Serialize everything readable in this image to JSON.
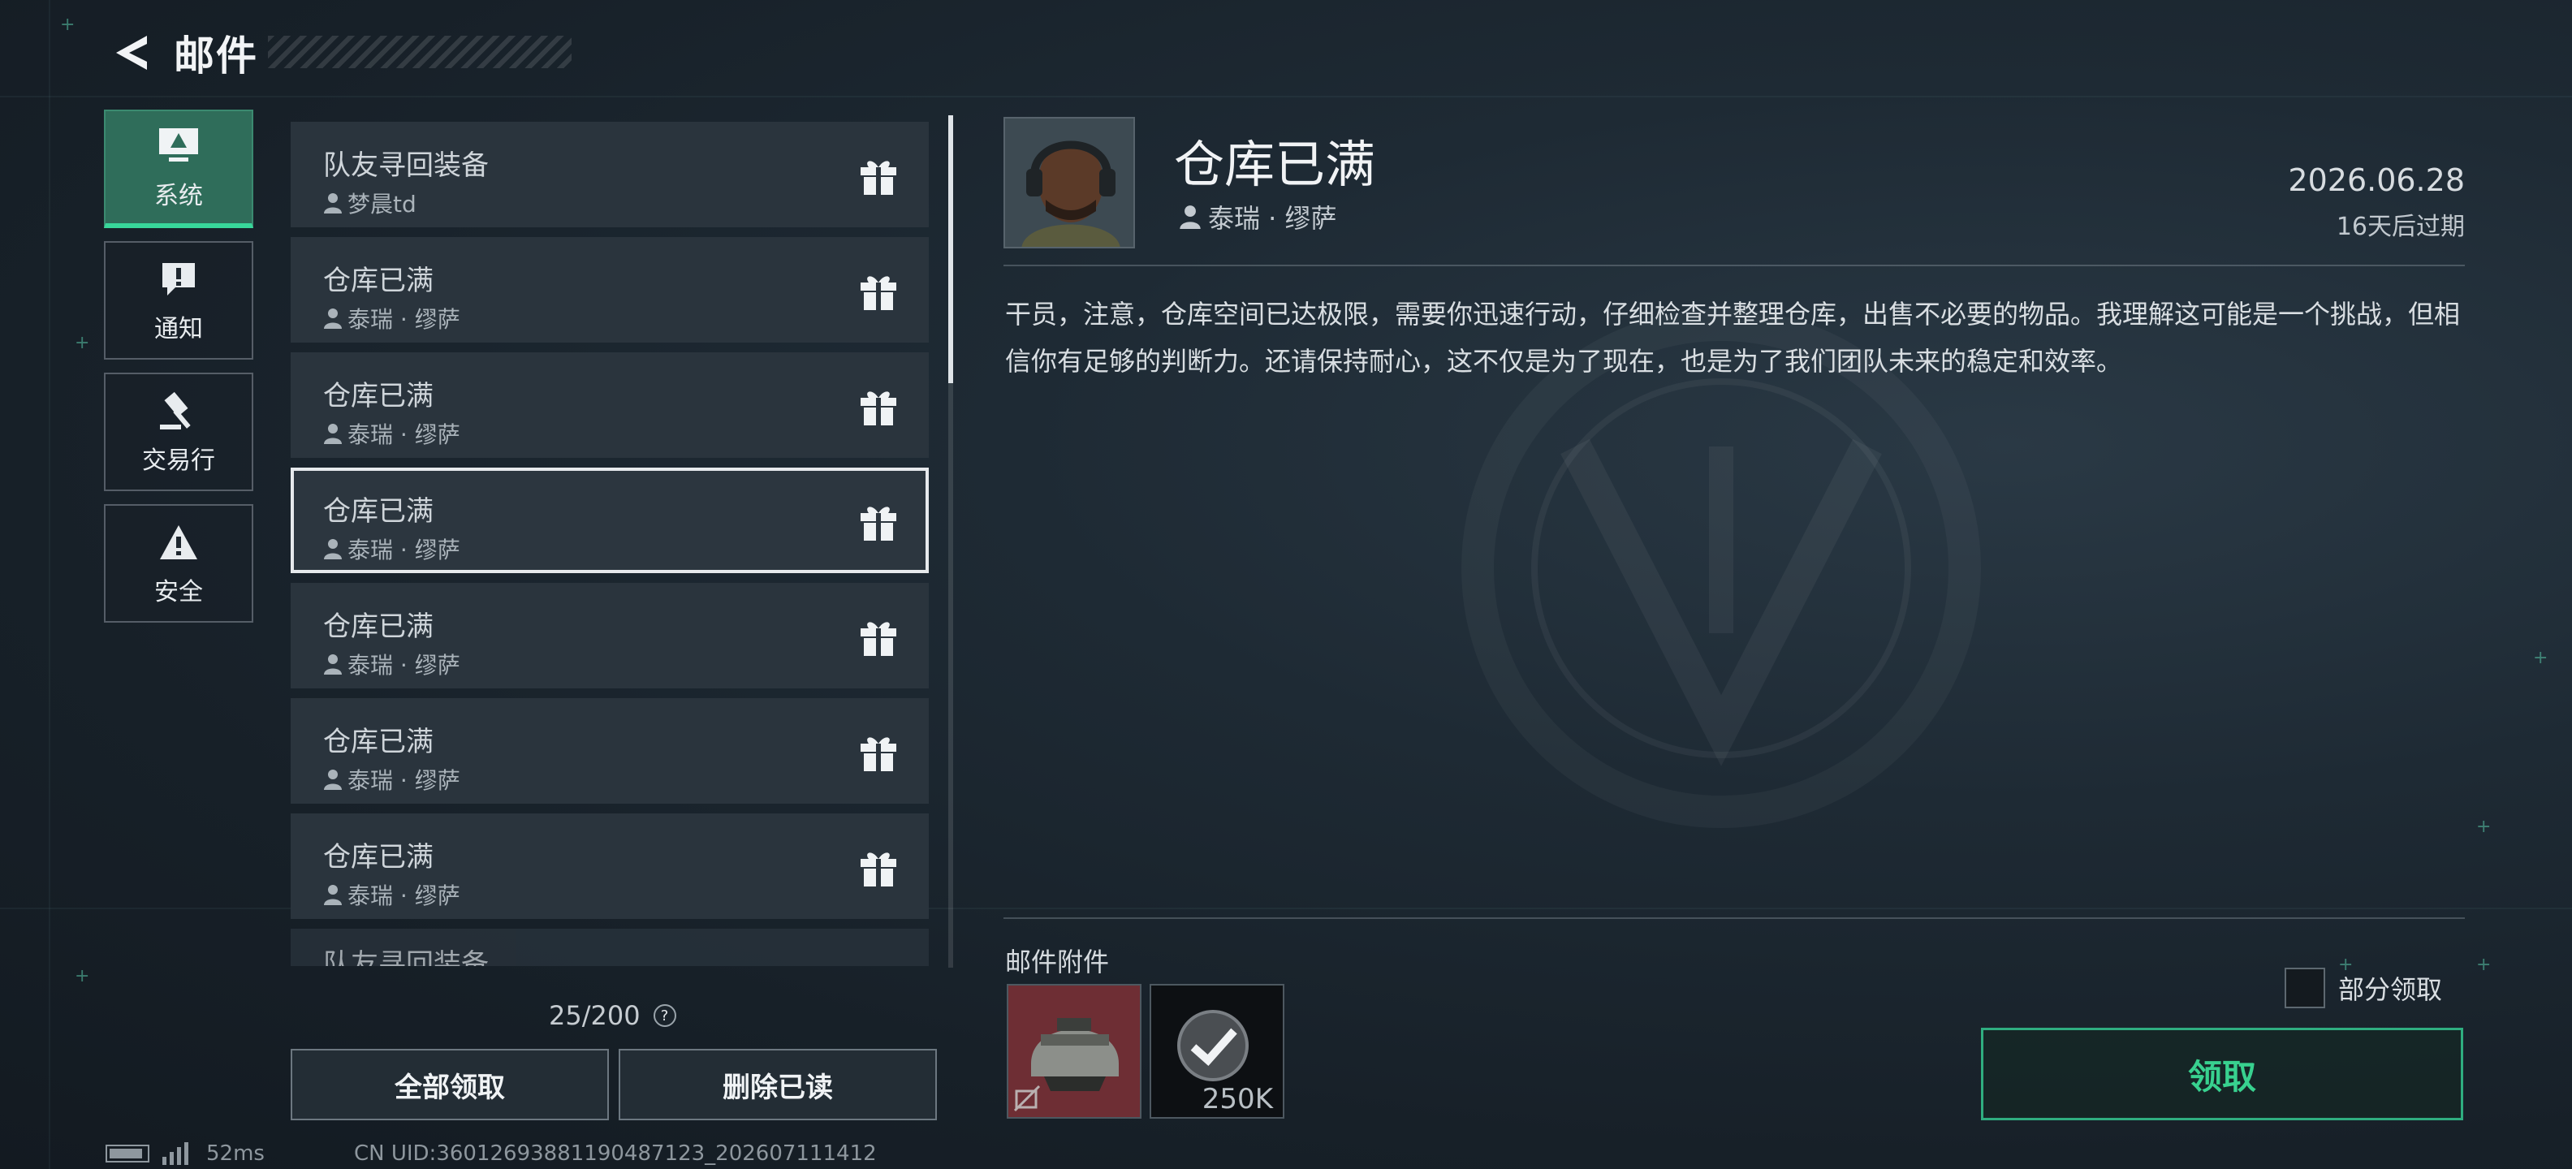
{
  "header": {
    "title": "邮件",
    "back_icon": "back-arrow-icon"
  },
  "categories": [
    {
      "label": "系统",
      "icon": "monitor-icon",
      "active": true
    },
    {
      "label": "通知",
      "icon": "alert-message-icon",
      "active": false
    },
    {
      "label": "交易行",
      "icon": "gavel-icon",
      "active": false
    },
    {
      "label": "安全",
      "icon": "warning-triangle-icon",
      "active": false
    }
  ],
  "mail_list": [
    {
      "title": "队友寻回装备",
      "sender": "梦晨td",
      "icon": "gift-icon"
    },
    {
      "title": "仓库已满",
      "sender": "泰瑞 · 缪萨",
      "icon": "gift-icon"
    },
    {
      "title": "仓库已满",
      "sender": "泰瑞 · 缪萨",
      "icon": "gift-icon"
    },
    {
      "title": "仓库已满",
      "sender": "泰瑞 · 缪萨",
      "icon": "gift-icon",
      "selected": true
    },
    {
      "title": "仓库已满",
      "sender": "泰瑞 · 缪萨",
      "icon": "gift-icon"
    },
    {
      "title": "仓库已满",
      "sender": "泰瑞 · 缪萨",
      "icon": "gift-icon"
    },
    {
      "title": "仓库已满",
      "sender": "泰瑞 · 缪萨",
      "icon": "gift-icon"
    },
    {
      "title": "队友寻回装备",
      "partial": true
    }
  ],
  "mail_count": "25/200",
  "help_label": "?",
  "buttons": {
    "claim_all": "全部领取",
    "delete_read": "删除已读"
  },
  "status_bar": {
    "ping": "52ms",
    "uid": "CN UID:36012693881190487123_202607111412"
  },
  "detail": {
    "title": "仓库已满",
    "sender": "泰瑞 · 缪萨",
    "date": "2026.06.28",
    "expire": "16天后过期",
    "body": "干员，注意，仓库空间已达极限，需要你迅速行动，仔细检查并整理仓库，出售不必要的物品。我理解这可能是一个挑战，但相信你有足够的判断力。还请保持耐心，这不仅是为了现在，也是为了我们团队未来的稳定和效率。",
    "attachments_label": "邮件附件",
    "attachments": [
      {
        "name": "helmet",
        "icon": "helmet-icon",
        "tag_icon": "no-insure-icon"
      },
      {
        "name": "currency",
        "icon": "checkmark-coin-icon",
        "quantity": "250K"
      }
    ],
    "partial_claim_label": "部分领取",
    "claim_label": "领取"
  },
  "colors": {
    "accent_green": "#38d79a",
    "active_category_bg": "#2f6d5a",
    "claim_text": "#38d18f"
  }
}
